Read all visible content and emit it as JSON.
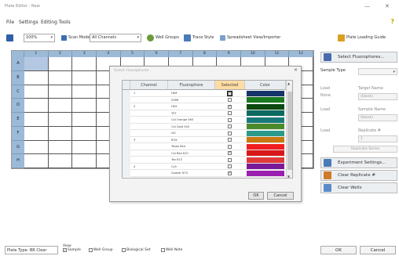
{
  "window": {
    "title": "Plate Editor - New",
    "minimize": "—",
    "close": "✕"
  },
  "menu": {
    "items": [
      "File",
      "Settings",
      "Editing Tools"
    ],
    "help": "?"
  },
  "toolbar": {
    "zoom": "100%",
    "scan_mode_label": "Scan Mode",
    "scan_mode_value": "All Channels",
    "well_groups": "Well Groups",
    "trace_style": "Trace Style",
    "spreadsheet": "Spreadsheet View/Importer",
    "plate_loading_guide": "Plate Loading Guide"
  },
  "plate": {
    "columns": [
      "1",
      "2",
      "3",
      "4",
      "5",
      "6",
      "7",
      "8",
      "9",
      "10",
      "11",
      "12"
    ],
    "rows": [
      "A",
      "B",
      "C",
      "D",
      "E",
      "F",
      "G",
      "H"
    ]
  },
  "right_panel": {
    "select_fluorophores": "Select Fluorophores...",
    "sample_type_label": "Sample Type",
    "load_label": "Load",
    "none_label": "None",
    "target_name_label": "Target Name",
    "target_name_value": "(blank)",
    "sample_name_label": "Sample Name",
    "sample_name_value": "(blank)",
    "replicate_label": "Replicate #",
    "replicate_value": "1",
    "replicate_series": "Replicate Series",
    "experiment_settings": "Experiment Settings...",
    "clear_replicate": "Clear Replicate #",
    "clear_wells": "Clear Wells"
  },
  "dialog": {
    "title": "Select Fluorophores",
    "close": "✕",
    "headers": [
      "Channel",
      "Fluorophore",
      "Selected",
      "Color"
    ],
    "rows": [
      {
        "channel": "1",
        "fluor": "FAM",
        "checked": true,
        "color": "#15336b"
      },
      {
        "channel": "",
        "fluor": "SYBR",
        "checked": false,
        "color": "#1a7a20"
      },
      {
        "channel": "2",
        "fluor": "HEX",
        "checked": true,
        "color": "#0c4a10"
      },
      {
        "channel": "",
        "fluor": "TET",
        "checked": false,
        "color": "#0c6a60"
      },
      {
        "channel": "",
        "fluor": "Cal Orange 560",
        "checked": false,
        "color": "#1a7a7a"
      },
      {
        "channel": "",
        "fluor": "Cal Gold 540",
        "checked": false,
        "color": "#4a8a2a"
      },
      {
        "channel": "",
        "fluor": "VIC",
        "checked": false,
        "color": "#2a9a8a"
      },
      {
        "channel": "3",
        "fluor": "ROX",
        "checked": false,
        "color": "#c8780e"
      },
      {
        "channel": "",
        "fluor": "Texas Red",
        "checked": false,
        "color": "#f02020"
      },
      {
        "channel": "",
        "fluor": "Cal Red 610",
        "checked": true,
        "color": "#d81818"
      },
      {
        "channel": "",
        "fluor": "Tex 615",
        "checked": false,
        "color": "#e03a3a"
      },
      {
        "channel": "4",
        "fluor": "Cy5",
        "checked": false,
        "color": "#7a1a9a"
      },
      {
        "channel": "",
        "fluor": "Quasar 670",
        "checked": true,
        "color": "#9a20b0"
      }
    ],
    "ok": "OK",
    "cancel": "Cancel"
  },
  "statusbar": {
    "plate_type": "Plate Type: BR Clear",
    "view_label": "View",
    "checks": [
      "Sample",
      "Well Group",
      "Biological Set",
      "Well Note"
    ],
    "ok": "OK",
    "cancel": "Cancel"
  },
  "colors": {
    "header_blue": "#9cbad8",
    "selected_cell": "#b4c8e4",
    "active_header": "#ffdca3"
  }
}
